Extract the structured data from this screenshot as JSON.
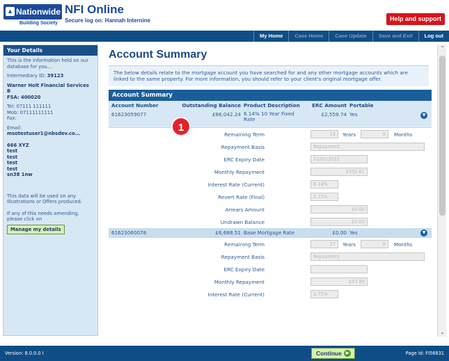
{
  "header": {
    "brand": "Nationwide",
    "brand_sub": "Building Society",
    "product": "NFI Online",
    "secure_log": "Secure log on: Hannah Internine",
    "help_label": "Help and support"
  },
  "nav": {
    "items": [
      {
        "label": "My Home",
        "active": true
      },
      {
        "label": "Case Home",
        "active": false
      },
      {
        "label": "Case Update",
        "active": false
      },
      {
        "label": "Save and Exit",
        "active": false
      },
      {
        "label": "Log out",
        "active": true
      }
    ]
  },
  "sidebar": {
    "title": "Your Details",
    "info": "This is the information held on our database for you...",
    "intermediary_label": "Intermediary ID:",
    "intermediary_id": "39123",
    "firm": "Warner Holt Financial Services B",
    "fsa_label": "FSA:",
    "fsa": "400020",
    "tel": "Tel: 07111 111111",
    "mob": "Mob: 07111111111",
    "fax": "Fax:",
    "email_label": "Email:",
    "email": "msotestuser1@nbsdev.co...",
    "address": [
      "666 XYZ",
      "test",
      "test",
      "test",
      "test",
      "sn38 1nw"
    ],
    "usage_note": "This data will be used on any Illustrations or Offers produced.",
    "amend_note": "If any of this needs amending, please click on",
    "manage_label": "Manage my details"
  },
  "main": {
    "title": "Account Summary",
    "intro": "The below details relate to the mortgage account you have searched for and any other mortgage accounts which are linked to the same property. For more information, you should refer to your client's original mortgage offer.",
    "section_title": "Account Summary",
    "columns": {
      "account": "Account Number",
      "balance": "Outstanding Balance",
      "product": "Product Description",
      "erc": "ERC Amount",
      "portable": "Portable"
    },
    "accounts": [
      {
        "number": "61623059077",
        "balance": "£86,042.24",
        "product": "6.14% 10 Year Fixed Rate",
        "erc": "£2,559.74",
        "portable": "Yes",
        "details": {
          "remaining_term_label": "Remaining Term",
          "years": "13",
          "years_unit": "Years",
          "months": "5",
          "months_unit": "Months",
          "repayment_basis_label": "Repayment Basis",
          "repayment_basis": "Repayment",
          "erc_expiry_label": "ERC Expiry Date",
          "erc_expiry": "31/01/2021",
          "monthly_repayment_label": "Monthly Repayment",
          "monthly_repayment": "£552.61",
          "interest_rate_label": "Interest Rate (Current)",
          "interest_rate": "6.14%",
          "revert_rate_label": "Revert Rate (Final)",
          "revert_rate": "2.75%",
          "arrears_label": "Arrears Amount",
          "arrears": "£0.00",
          "undrawn_label": "Undrawn Balance",
          "undrawn": "£0.00"
        }
      },
      {
        "number": "61623060078",
        "balance": "£6,688.51",
        "product": "Base Mortgage Rate",
        "erc": "£0.00",
        "portable": "Yes",
        "details": {
          "remaining_term_label": "Remaining Term",
          "years": "17",
          "years_unit": "Years",
          "months": "5",
          "months_unit": "Months",
          "repayment_basis_label": "Repayment Basis",
          "repayment_basis": "Repayment",
          "erc_expiry_label": "ERC Expiry Date",
          "erc_expiry": "",
          "monthly_repayment_label": "Monthly Repayment",
          "monthly_repayment": "£47.89",
          "interest_rate_label": "Interest Rate (Current)",
          "interest_rate": "2.75%"
        }
      }
    ]
  },
  "marker": "1",
  "footer": {
    "version": "Version: 8.0.0.0 I",
    "continue_label": "Continue",
    "page_id": "Page Id: FI56831"
  }
}
